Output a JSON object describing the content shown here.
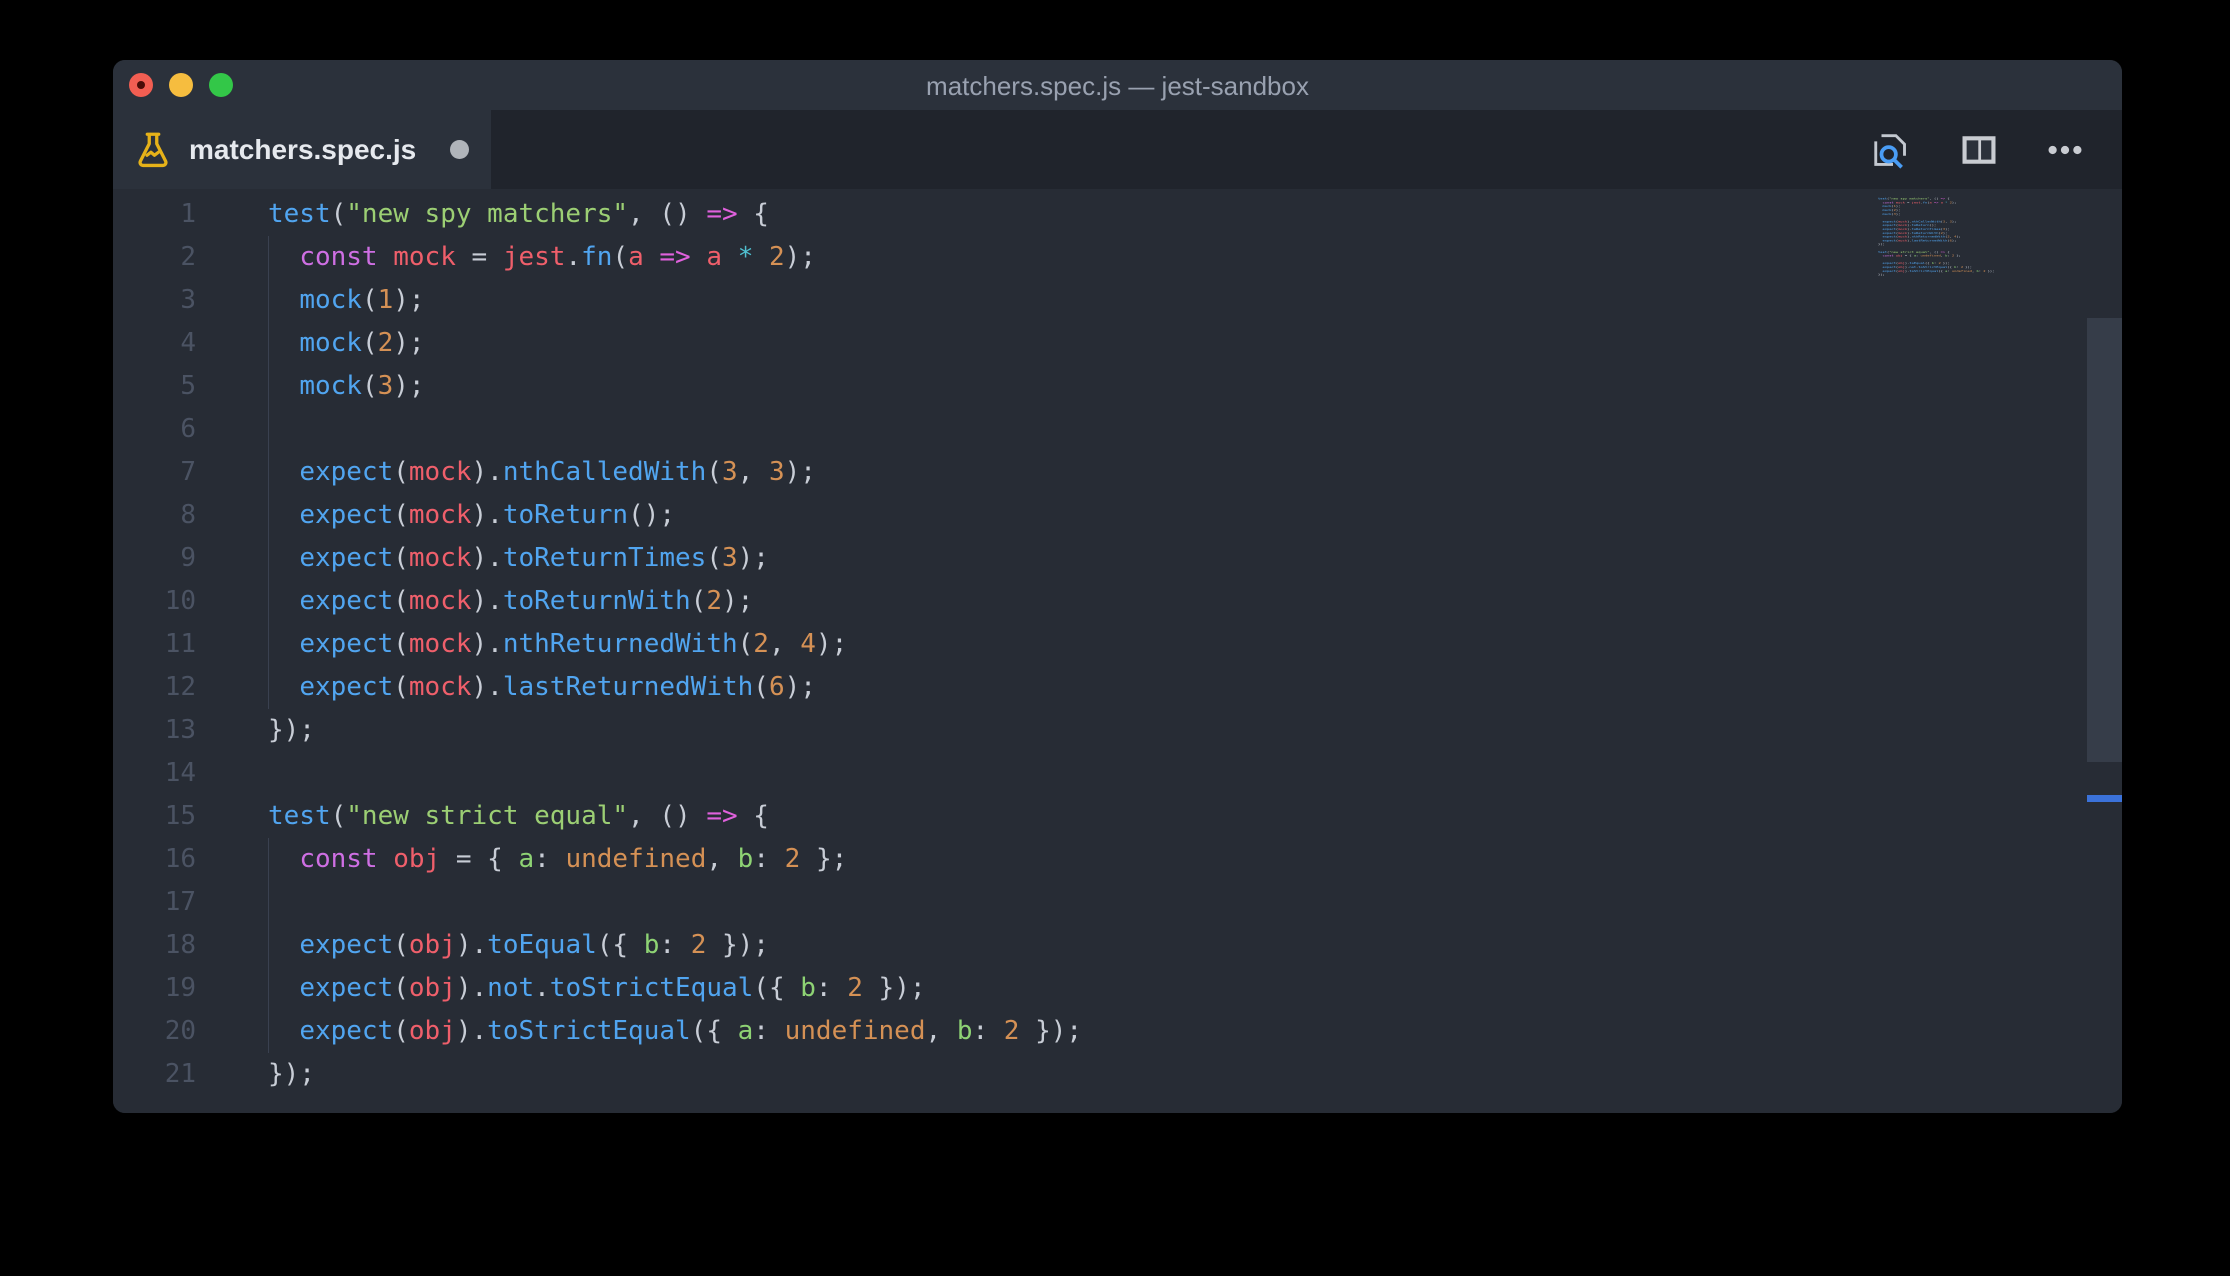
{
  "window": {
    "title": "matchers.spec.js — jest-sandbox"
  },
  "tab": {
    "filename": "matchers.spec.js",
    "modified": true,
    "icon": "flask-test-icon"
  },
  "tab_actions": [
    {
      "name": "open-changes-icon",
      "label": "Open Changes / Search in file"
    },
    {
      "name": "split-editor-icon",
      "label": "Split Editor"
    },
    {
      "name": "more-actions-icon",
      "label": "More Actions"
    }
  ],
  "colors": {
    "titlebar_bg": "#2b313b",
    "tabstrip_bg": "#20242c",
    "active_tab_bg": "#2b313b",
    "editor_bg": "#272c35",
    "gutter_fg": "#4b5363",
    "title_fg": "#99a1b0",
    "tab_label_fg": "#e6e9ee",
    "traffic_red": "#f25e52",
    "traffic_yellow": "#f6bd3f",
    "traffic_green": "#33c748",
    "flask_gold": "#e6b219",
    "icon_gray": "#c3c8d0",
    "magnifier_blue": "#4a9df5",
    "scrollbar_thumb": "#363d49",
    "overview_marker_blue": "#3b72d9",
    "tokens": {
      "fn": "#51a5f0",
      "var": "#ef5f6b",
      "kw": "#ce6fe3",
      "str": "#9ccf74",
      "key": "#8ed374",
      "num": "#d59155",
      "op": "#4fc0d0",
      "arrow": "#e061dd",
      "pun": "#c8cdd6"
    }
  },
  "editor": {
    "indent_guides": [
      {
        "from_line": 2,
        "to_line": 12
      },
      {
        "from_line": 16,
        "to_line": 20
      }
    ],
    "lines": [
      {
        "num": "1",
        "tokens": [
          [
            "fn",
            "test"
          ],
          [
            "pun",
            "("
          ],
          [
            "str",
            "\"new spy matchers\""
          ],
          [
            "pun",
            ", () "
          ],
          [
            "arrow",
            "=>"
          ],
          [
            "pun",
            " {"
          ]
        ]
      },
      {
        "num": "2",
        "tokens": [
          [
            "pun",
            "  "
          ],
          [
            "kw",
            "const"
          ],
          [
            "pun",
            " "
          ],
          [
            "var",
            "mock"
          ],
          [
            "pun",
            " = "
          ],
          [
            "var",
            "jest"
          ],
          [
            "pun",
            "."
          ],
          [
            "fn",
            "fn"
          ],
          [
            "pun",
            "("
          ],
          [
            "var",
            "a"
          ],
          [
            "pun",
            " "
          ],
          [
            "arrow",
            "=>"
          ],
          [
            "pun",
            " "
          ],
          [
            "var",
            "a"
          ],
          [
            "pun",
            " "
          ],
          [
            "op",
            "*"
          ],
          [
            "pun",
            " "
          ],
          [
            "num",
            "2"
          ],
          [
            "pun",
            ");"
          ]
        ]
      },
      {
        "num": "3",
        "tokens": [
          [
            "pun",
            "  "
          ],
          [
            "fn",
            "mock"
          ],
          [
            "pun",
            "("
          ],
          [
            "num",
            "1"
          ],
          [
            "pun",
            ");"
          ]
        ]
      },
      {
        "num": "4",
        "tokens": [
          [
            "pun",
            "  "
          ],
          [
            "fn",
            "mock"
          ],
          [
            "pun",
            "("
          ],
          [
            "num",
            "2"
          ],
          [
            "pun",
            ");"
          ]
        ]
      },
      {
        "num": "5",
        "tokens": [
          [
            "pun",
            "  "
          ],
          [
            "fn",
            "mock"
          ],
          [
            "pun",
            "("
          ],
          [
            "num",
            "3"
          ],
          [
            "pun",
            ");"
          ]
        ]
      },
      {
        "num": "6",
        "tokens": []
      },
      {
        "num": "7",
        "tokens": [
          [
            "pun",
            "  "
          ],
          [
            "fn",
            "expect"
          ],
          [
            "pun",
            "("
          ],
          [
            "var",
            "mock"
          ],
          [
            "pun",
            ")."
          ],
          [
            "fn",
            "nthCalledWith"
          ],
          [
            "pun",
            "("
          ],
          [
            "num",
            "3"
          ],
          [
            "pun",
            ", "
          ],
          [
            "num",
            "3"
          ],
          [
            "pun",
            ");"
          ]
        ]
      },
      {
        "num": "8",
        "tokens": [
          [
            "pun",
            "  "
          ],
          [
            "fn",
            "expect"
          ],
          [
            "pun",
            "("
          ],
          [
            "var",
            "mock"
          ],
          [
            "pun",
            ")."
          ],
          [
            "fn",
            "toReturn"
          ],
          [
            "pun",
            "();"
          ]
        ]
      },
      {
        "num": "9",
        "tokens": [
          [
            "pun",
            "  "
          ],
          [
            "fn",
            "expect"
          ],
          [
            "pun",
            "("
          ],
          [
            "var",
            "mock"
          ],
          [
            "pun",
            ")."
          ],
          [
            "fn",
            "toReturnTimes"
          ],
          [
            "pun",
            "("
          ],
          [
            "num",
            "3"
          ],
          [
            "pun",
            ");"
          ]
        ]
      },
      {
        "num": "10",
        "tokens": [
          [
            "pun",
            "  "
          ],
          [
            "fn",
            "expect"
          ],
          [
            "pun",
            "("
          ],
          [
            "var",
            "mock"
          ],
          [
            "pun",
            ")."
          ],
          [
            "fn",
            "toReturnWith"
          ],
          [
            "pun",
            "("
          ],
          [
            "num",
            "2"
          ],
          [
            "pun",
            ");"
          ]
        ]
      },
      {
        "num": "11",
        "tokens": [
          [
            "pun",
            "  "
          ],
          [
            "fn",
            "expect"
          ],
          [
            "pun",
            "("
          ],
          [
            "var",
            "mock"
          ],
          [
            "pun",
            ")."
          ],
          [
            "fn",
            "nthReturnedWith"
          ],
          [
            "pun",
            "("
          ],
          [
            "num",
            "2"
          ],
          [
            "pun",
            ", "
          ],
          [
            "num",
            "4"
          ],
          [
            "pun",
            ");"
          ]
        ]
      },
      {
        "num": "12",
        "tokens": [
          [
            "pun",
            "  "
          ],
          [
            "fn",
            "expect"
          ],
          [
            "pun",
            "("
          ],
          [
            "var",
            "mock"
          ],
          [
            "pun",
            ")."
          ],
          [
            "fn",
            "lastReturnedWith"
          ],
          [
            "pun",
            "("
          ],
          [
            "num",
            "6"
          ],
          [
            "pun",
            ");"
          ]
        ]
      },
      {
        "num": "13",
        "tokens": [
          [
            "pun",
            "});"
          ]
        ]
      },
      {
        "num": "14",
        "tokens": []
      },
      {
        "num": "15",
        "tokens": [
          [
            "fn",
            "test"
          ],
          [
            "pun",
            "("
          ],
          [
            "str",
            "\"new strict equal\""
          ],
          [
            "pun",
            ", () "
          ],
          [
            "arrow",
            "=>"
          ],
          [
            "pun",
            " {"
          ]
        ]
      },
      {
        "num": "16",
        "tokens": [
          [
            "pun",
            "  "
          ],
          [
            "kw",
            "const"
          ],
          [
            "pun",
            " "
          ],
          [
            "var",
            "obj"
          ],
          [
            "pun",
            " = { "
          ],
          [
            "key",
            "a"
          ],
          [
            "pun",
            ": "
          ],
          [
            "num",
            "undefined"
          ],
          [
            "pun",
            ", "
          ],
          [
            "key",
            "b"
          ],
          [
            "pun",
            ": "
          ],
          [
            "num",
            "2"
          ],
          [
            "pun",
            " };"
          ]
        ]
      },
      {
        "num": "17",
        "tokens": []
      },
      {
        "num": "18",
        "tokens": [
          [
            "pun",
            "  "
          ],
          [
            "fn",
            "expect"
          ],
          [
            "pun",
            "("
          ],
          [
            "var",
            "obj"
          ],
          [
            "pun",
            ")."
          ],
          [
            "fn",
            "toEqual"
          ],
          [
            "pun",
            "({ "
          ],
          [
            "key",
            "b"
          ],
          [
            "pun",
            ": "
          ],
          [
            "num",
            "2"
          ],
          [
            "pun",
            " });"
          ]
        ]
      },
      {
        "num": "19",
        "tokens": [
          [
            "pun",
            "  "
          ],
          [
            "fn",
            "expect"
          ],
          [
            "pun",
            "("
          ],
          [
            "var",
            "obj"
          ],
          [
            "pun",
            ")."
          ],
          [
            "fn",
            "not"
          ],
          [
            "pun",
            "."
          ],
          [
            "fn",
            "toStrictEqual"
          ],
          [
            "pun",
            "({ "
          ],
          [
            "key",
            "b"
          ],
          [
            "pun",
            ": "
          ],
          [
            "num",
            "2"
          ],
          [
            "pun",
            " });"
          ]
        ]
      },
      {
        "num": "20",
        "tokens": [
          [
            "pun",
            "  "
          ],
          [
            "fn",
            "expect"
          ],
          [
            "pun",
            "("
          ],
          [
            "var",
            "obj"
          ],
          [
            "pun",
            ")."
          ],
          [
            "fn",
            "toStrictEqual"
          ],
          [
            "pun",
            "({ "
          ],
          [
            "key",
            "a"
          ],
          [
            "pun",
            ": "
          ],
          [
            "num",
            "undefined"
          ],
          [
            "pun",
            ", "
          ],
          [
            "key",
            "b"
          ],
          [
            "pun",
            ": "
          ],
          [
            "num",
            "2"
          ],
          [
            "pun",
            " });"
          ]
        ]
      },
      {
        "num": "21",
        "tokens": [
          [
            "pun",
            "});"
          ]
        ]
      }
    ]
  }
}
